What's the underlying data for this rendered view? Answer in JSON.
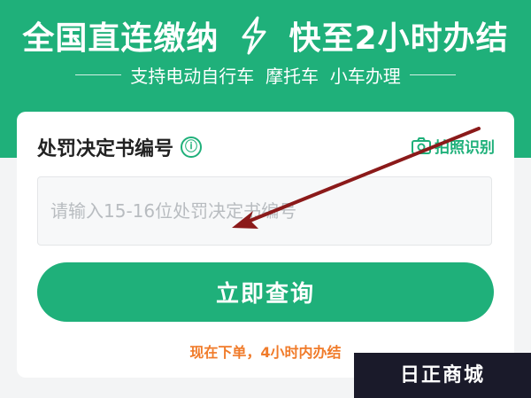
{
  "banner": {
    "title_left": "全国直连缴纳",
    "title_right": "快至2小时办结",
    "subtitle": "支持电动自行车  摩托车  小车办理",
    "bg_color": "#1fb07a"
  },
  "form": {
    "label": "处罚决定书编号",
    "info_icon": "ⓘ",
    "photo_label": "拍照识别",
    "input_placeholder": "请输入15-16位处罚决定书编号",
    "input_value": "",
    "submit_label": "立即查询",
    "note": "现在下单，4小时内办结",
    "accent_color": "#1fb07a",
    "note_color": "#f07b2a"
  },
  "watermark": {
    "text": "日正商城"
  }
}
